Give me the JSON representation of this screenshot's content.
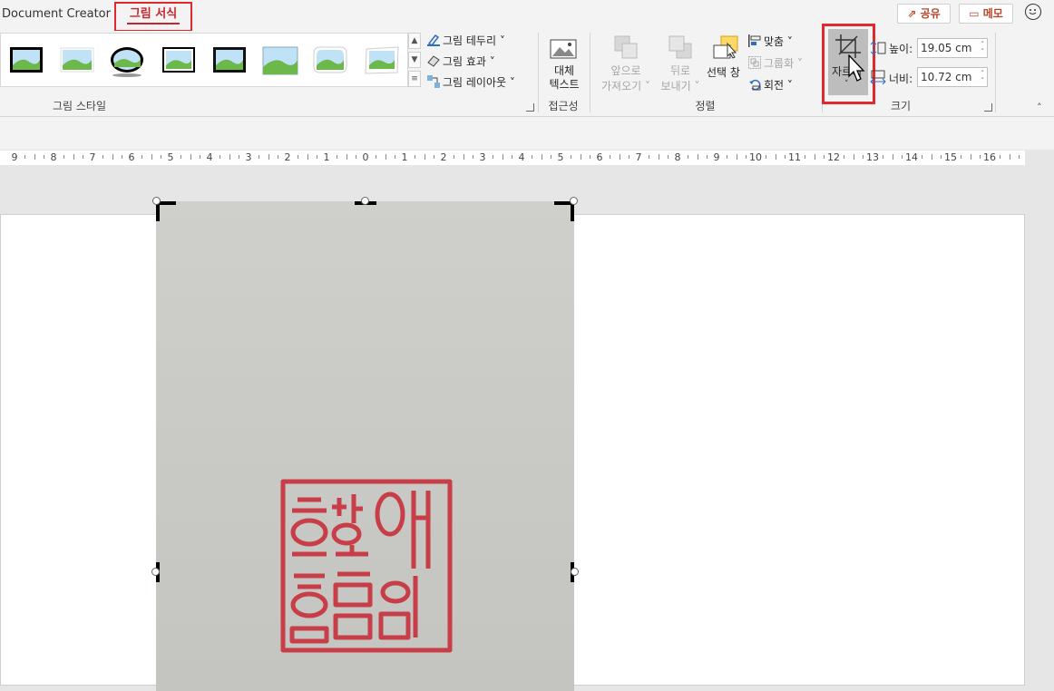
{
  "app": {
    "title": "Document Creator"
  },
  "tabs": {
    "picture_format": "그림 서식"
  },
  "topbar": {
    "share": "공유",
    "memo": "메모"
  },
  "picture_styles": {
    "group_label": "그림 스타일",
    "border": "그림 테두리",
    "effects": "그림 효과",
    "layout": "그림 레이아웃"
  },
  "accessibility": {
    "group_label": "접근성",
    "alt_text_line1": "대체",
    "alt_text_line2": "텍스트"
  },
  "arrange": {
    "group_label": "정렬",
    "bring_forward_line1": "앞으로",
    "bring_forward_line2": "가져오기",
    "send_backward_line1": "뒤로",
    "send_backward_line2": "보내기",
    "selection_pane": "선택 창",
    "align": "맞춤",
    "group": "그룹화",
    "rotate": "회전"
  },
  "size": {
    "group_label": "크기",
    "crop": "자르기",
    "height_label": "높이:",
    "height_value": "19.05 cm",
    "width_label": "너비:",
    "width_value": "10.72 cm"
  },
  "ruler": {
    "labels": [
      "9",
      "8",
      "7",
      "6",
      "5",
      "4",
      "3",
      "2",
      "1",
      "0",
      "1",
      "2",
      "3",
      "4",
      "5",
      "6",
      "7",
      "8",
      "9",
      "10",
      "11",
      "12",
      "13",
      "14",
      "15",
      "16"
    ]
  },
  "seal": {
    "text": "이현예 이한이"
  },
  "colors": {
    "accent": "#c4262d",
    "highlight": "#e0282e",
    "seal_red": "#c9333e"
  }
}
